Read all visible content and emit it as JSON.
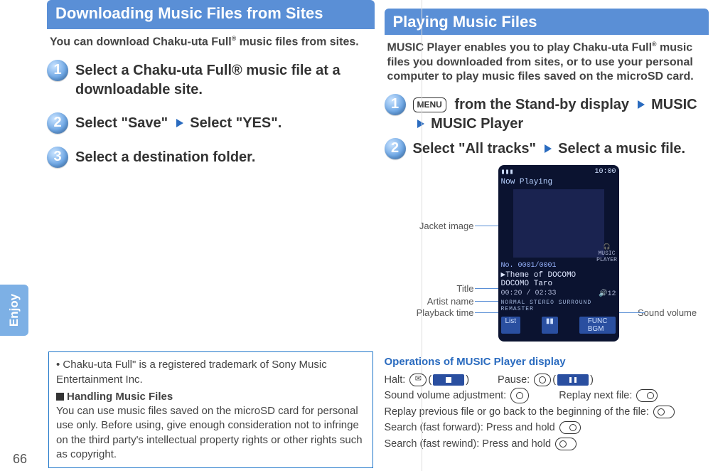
{
  "page_number": "66",
  "side_tab": "Enjoy",
  "left": {
    "title": "Downloading Music Files from Sites",
    "intro_a": "You can download Chaku-uta Full",
    "intro_b": " music files from sites.",
    "step1": "Select a Chaku-uta Full® music file at a downloadable site.",
    "step2_a": "Select \"Save\"",
    "step2_b": "Select \"YES\".",
    "step3": "Select a destination folder.",
    "info_bullet": "Chaku-uta Full\" is a registered trademark of Sony Music Entertainment Inc.",
    "info_head": "Handling Music Files",
    "info_body": "You can use music files saved on the microSD card for personal use only. Before using, give enough consideration not to infringe on the third party's intellectual property rights or other rights such as copyright."
  },
  "right": {
    "title": "Playing Music Files",
    "intro_a": "MUSIC Player enables you to play Chaku-uta Full",
    "intro_b": " music files you downloaded from sites, or to use your personal computer to play music files saved on the microSD card.",
    "menu_label": "MENU",
    "step1_a": "from the Stand-by display",
    "step1_b": "MUSIC",
    "step1_c": "MUSIC Player",
    "step2_a": "Select \"All tracks\"",
    "step2_b": "Select a music file.",
    "labels": {
      "jacket": "Jacket image",
      "title": "Title",
      "artist": "Artist name",
      "playback": "Playback time",
      "volume": "Sound volume"
    },
    "phone": {
      "time": "10:00",
      "now_playing": "Now Playing",
      "counter": "No. 0001/0001",
      "title": "Theme of DOCOMO",
      "artist": "DOCOMO Taro",
      "elapsed": "00:20",
      "total": "02:33",
      "vol": "12",
      "flags": "NORMAL  STEREO  SURROUND  REMASTER",
      "sk_left": "List",
      "sk_right": "FUNC",
      "sk_right2": "BGM",
      "mplogo": "MUSIC PLAYER"
    },
    "ops_title": "Operations of MUSIC Player display",
    "ops": {
      "halt": "Halt:",
      "pause": "Pause:",
      "vol": "Sound volume adjustment:",
      "next": "Replay next file:",
      "prev": "Replay previous file or go back to the beginning of the file:",
      "ff": "Search (fast forward): Press and hold",
      "rw": "Search (fast rewind): Press and hold"
    }
  }
}
